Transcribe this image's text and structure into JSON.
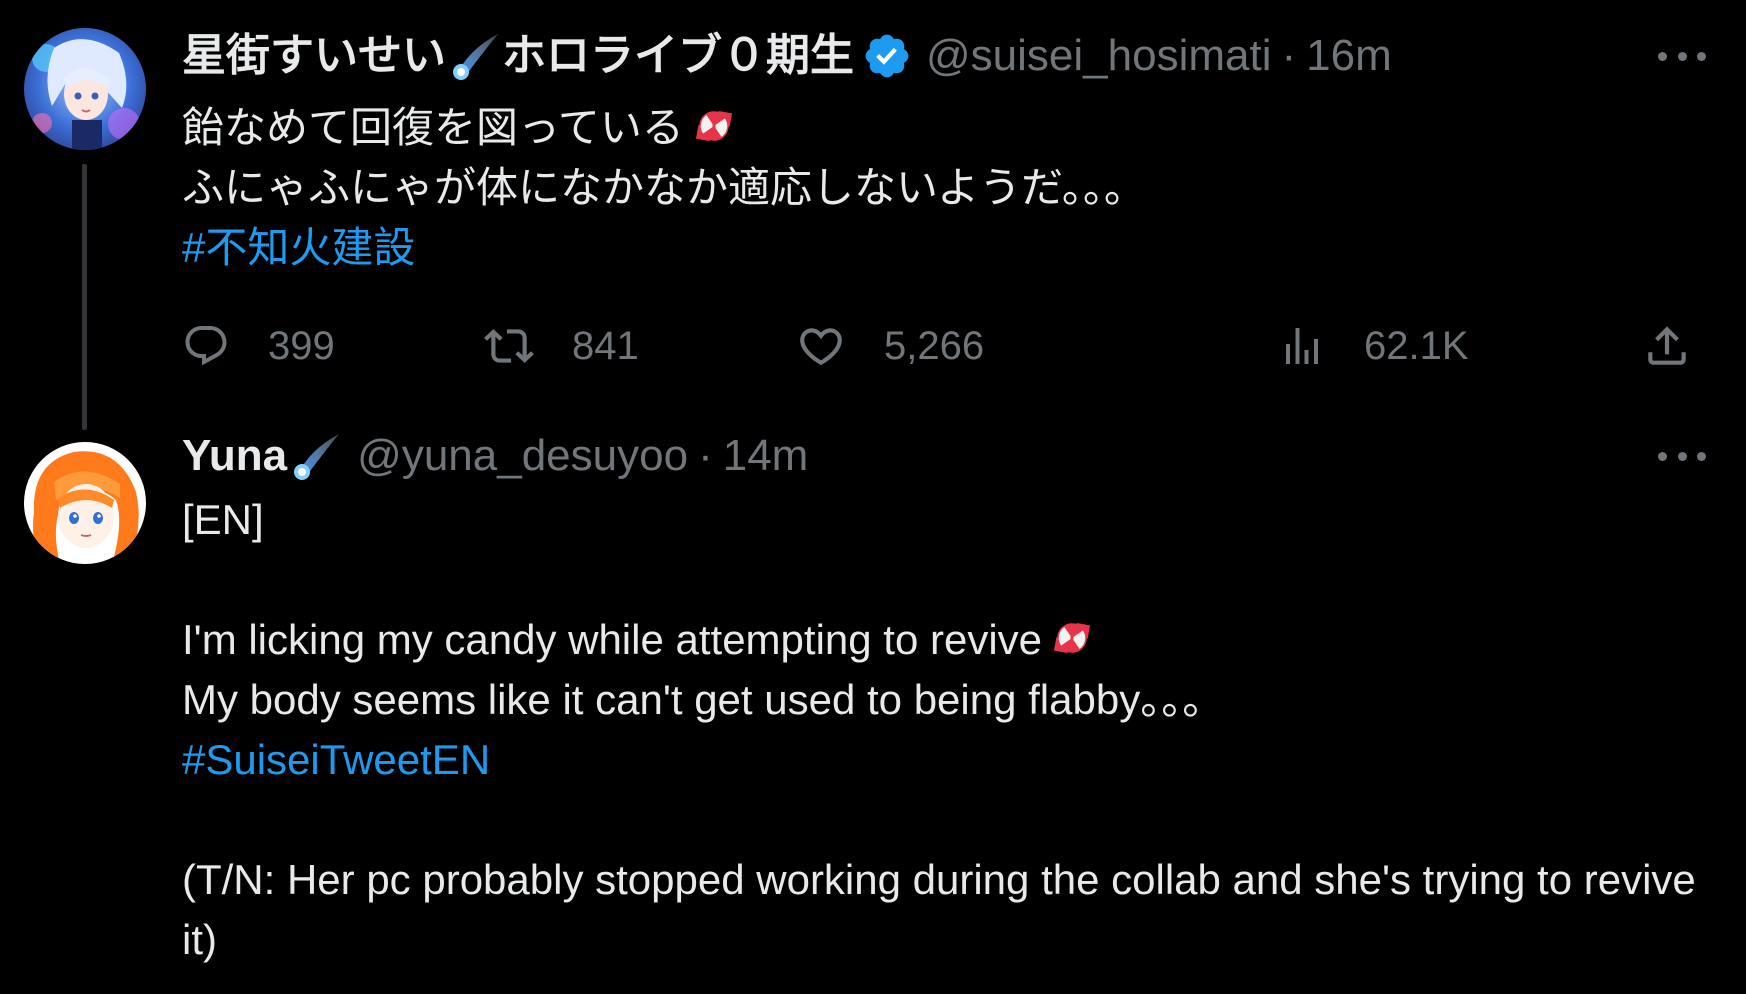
{
  "tweets": [
    {
      "display_name": "星街すいせい",
      "name_suffix": "ホロライブ０期生",
      "handle": "@suisei_hosimati",
      "separator": "·",
      "time": "16m",
      "verified": true,
      "lines": [
        "飴なめて回復を図っている",
        "ふにゃふにゃが体になかなか適応しないようだ。。。"
      ],
      "hashtag": "#不知火建設",
      "stats": {
        "replies": "399",
        "retweets": "841",
        "likes": "5,266",
        "views": "62.1K"
      }
    },
    {
      "display_name": "Yuna",
      "handle": "@yuna_desuyoo",
      "separator": "·",
      "time": "14m",
      "verified": false,
      "lines": [
        "[EN]",
        "I'm licking my candy while attempting to revive",
        "My body seems like it can't get used to being flabby。。。"
      ],
      "hashtag": "#SuiseiTweetEN",
      "note": "(T/N: Her pc probably stopped working during the collab and she's trying to revive it)"
    }
  ],
  "icons": {
    "more": "more-horizontal-icon",
    "reply": "reply-icon",
    "retweet": "retweet-icon",
    "like": "heart-icon",
    "views": "views-chart-icon",
    "share": "share-icon",
    "emoji_comet": "comet-emoji",
    "emoji_candy": "candy-emoji",
    "verified": "verified-badge-icon"
  },
  "colors": {
    "background": "#000000",
    "text": "#e7e9ea",
    "secondary": "#71767b",
    "link": "#1d9bf0",
    "thread_line": "#333639"
  }
}
